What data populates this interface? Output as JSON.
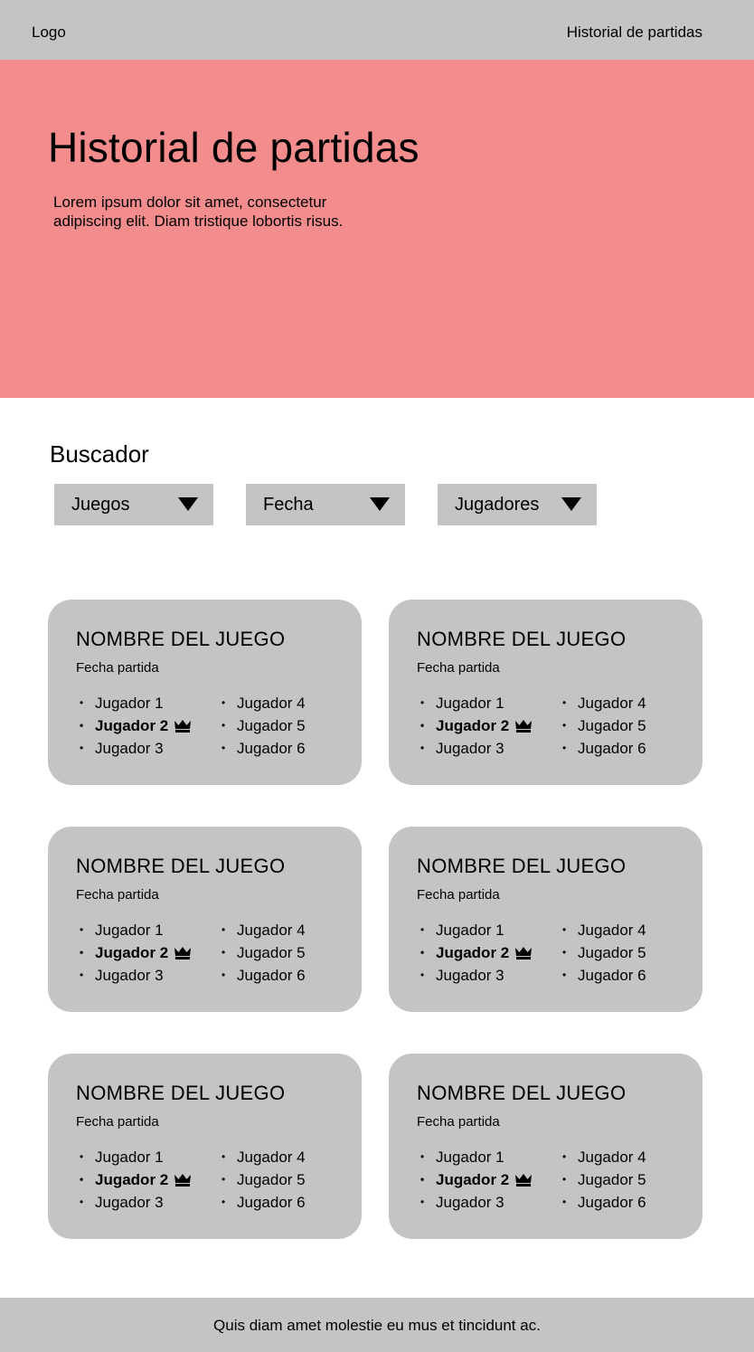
{
  "header": {
    "logo": "Logo",
    "nav_link": "Historial de partidas"
  },
  "hero": {
    "title": "Historial de partidas",
    "description": "Lorem ipsum dolor sit amet, consectetur adipiscing elit. Diam tristique lobortis risus."
  },
  "search": {
    "title": "Buscador",
    "filters": [
      "Juegos",
      "Fecha",
      "Jugadores"
    ]
  },
  "cards": [
    {
      "title": "NOMBRE DEL JUEGO",
      "date": "Fecha partida",
      "players": [
        "Jugador 1",
        "Jugador 2",
        "Jugador 3",
        "Jugador 4",
        "Jugador 5",
        "Jugador 6"
      ],
      "winner": "Jugador 2"
    },
    {
      "title": "NOMBRE DEL JUEGO",
      "date": "Fecha partida",
      "players": [
        "Jugador 1",
        "Jugador 2",
        "Jugador 3",
        "Jugador 4",
        "Jugador 5",
        "Jugador 6"
      ],
      "winner": "Jugador 2"
    },
    {
      "title": "NOMBRE DEL JUEGO",
      "date": "Fecha partida",
      "players": [
        "Jugador 1",
        "Jugador 2",
        "Jugador 3",
        "Jugador 4",
        "Jugador 5",
        "Jugador 6"
      ],
      "winner": "Jugador 2"
    },
    {
      "title": "NOMBRE DEL JUEGO",
      "date": "Fecha partida",
      "players": [
        "Jugador 1",
        "Jugador 2",
        "Jugador 3",
        "Jugador 4",
        "Jugador 5",
        "Jugador 6"
      ],
      "winner": "Jugador 2"
    },
    {
      "title": "NOMBRE DEL JUEGO",
      "date": "Fecha partida",
      "players": [
        "Jugador 1",
        "Jugador 2",
        "Jugador 3",
        "Jugador 4",
        "Jugador 5",
        "Jugador 6"
      ],
      "winner": "Jugador 2"
    },
    {
      "title": "NOMBRE DEL JUEGO",
      "date": "Fecha partida",
      "players": [
        "Jugador 1",
        "Jugador 2",
        "Jugador 3",
        "Jugador 4",
        "Jugador 5",
        "Jugador 6"
      ],
      "winner": "Jugador 2"
    }
  ],
  "footer": {
    "text": "Quis diam amet molestie eu mus et tincidunt ac."
  },
  "icons": {
    "dropdown": "caret-down-icon",
    "winner": "crown-icon"
  },
  "colors": {
    "header_bg": "#c4c4c4",
    "hero_bg": "#f38c8c",
    "card_bg": "#c4c4c4",
    "text": "#000000"
  }
}
